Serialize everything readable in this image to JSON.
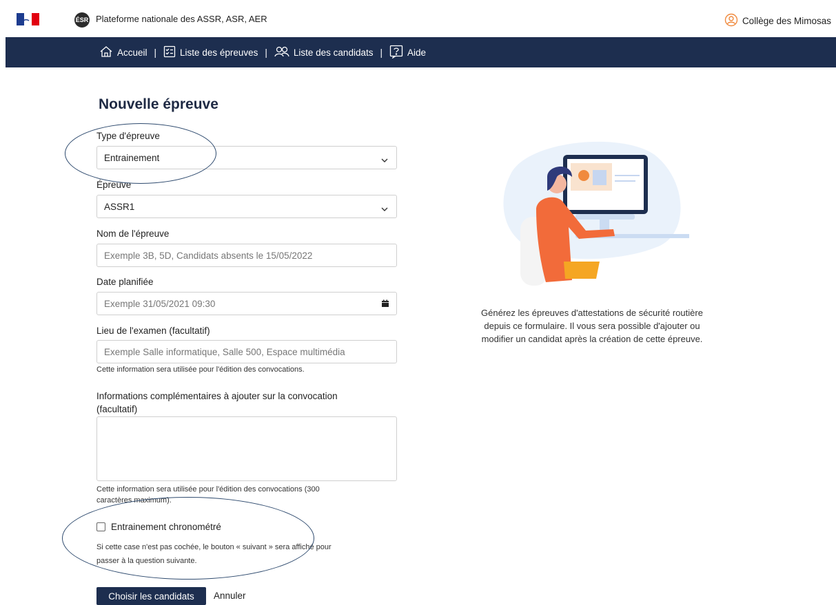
{
  "header": {
    "site_title": "Plateforme nationale des ASSR, ASR, AER",
    "esr_logo_text": "ÉSR",
    "user_name": "Collège des Mimosas"
  },
  "nav": {
    "items": [
      {
        "label": "Accueil",
        "icon": "home-icon"
      },
      {
        "label": "Liste des épreuves",
        "icon": "checklist-icon"
      },
      {
        "label": "Liste des candidats",
        "icon": "users-icon"
      },
      {
        "label": "Aide",
        "icon": "help-icon"
      }
    ],
    "separator": "|"
  },
  "form": {
    "title": "Nouvelle épreuve",
    "type_label": "Type d'épreuve",
    "type_value": "Entrainement",
    "epreuve_label": "Épreuve",
    "epreuve_value": "ASSR1",
    "nom_label": "Nom de l'épreuve",
    "nom_placeholder": "Exemple 3B, 5D, Candidats absents le 15/05/2022",
    "date_label": "Date planifiée",
    "date_placeholder": "Exemple 31/05/2021 09:30",
    "lieu_label": "Lieu de l'examen (facultatif)",
    "lieu_placeholder": "Exemple Salle informatique, Salle 500, Espace multimédia",
    "lieu_help": "Cette information sera utilisée pour l'édition des convocations.",
    "info_label_line1": "Informations complémentaires à ajouter sur la convocation",
    "info_label_line2": "(facultatif)",
    "info_help_line1": "Cette information sera utilisée pour l'édition des convocations (300",
    "info_help_line2": "caractères maximum).",
    "chrono_label": "Entrainement chronométré",
    "chrono_checked": false,
    "chrono_help_line1": "Si cette case n'est pas cochée, le bouton « suivant » sera affiché pour",
    "chrono_help_line2": "passer à la question suivante.",
    "submit_label": "Choisir les candidats",
    "cancel_label": "Annuler"
  },
  "aside": {
    "text_line1": "Générez les épreuves d'attestations de sécurité routière",
    "text_line2": "depuis ce formulaire. Il vous sera possible d'ajouter ou",
    "text_line3": "modifier un candidat après la création de cette épreuve."
  },
  "colors": {
    "nav_bg": "#1d2e4f",
    "accent_orange": "#f08a3e",
    "annotation_ellipse": "#2e4a6e"
  }
}
